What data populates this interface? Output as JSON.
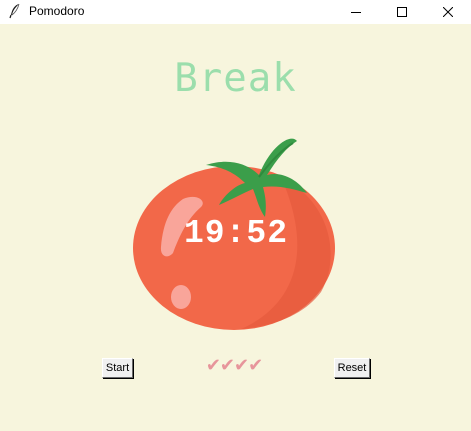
{
  "window": {
    "title": "Pomodoro",
    "icon": "feather-icon",
    "controls": [
      "minimize-icon",
      "maximize-icon",
      "close-icon"
    ]
  },
  "main": {
    "heading": "Break",
    "timer": "19:52",
    "checkmarks": "✔✔✔✔",
    "start_label": "Start",
    "reset_label": "Reset"
  },
  "colors": {
    "background": "#f7f5dd",
    "heading": "#9bdeac",
    "tomato": "#f26849",
    "leaves": "#3b9e4a",
    "checkmarks": "#e7959b"
  }
}
